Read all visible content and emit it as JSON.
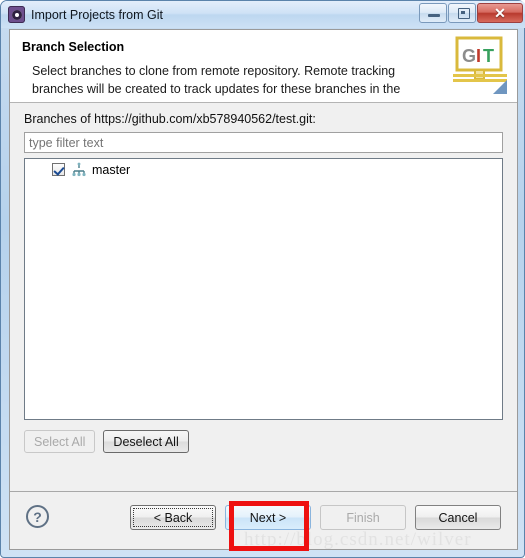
{
  "window": {
    "title": "Import Projects from Git",
    "icon": "eclipse-wizard-icon",
    "controls": {
      "minimize": "minimize-button",
      "restore": "restore-button",
      "close": "✕"
    }
  },
  "header": {
    "title": "Branch Selection",
    "description": "Select branches to clone from remote repository. Remote tracking\nbranches will be created to track updates for these branches in the",
    "logo": {
      "name": "git-logo",
      "letters": [
        "G",
        "I",
        "T"
      ],
      "colors": {
        "g": "#808080",
        "i": "#c0392b",
        "t": "#27ae60",
        "frame": "#d9b93c"
      }
    }
  },
  "content": {
    "branches_label": "Branches of https://github.com/xb578940562/test.git:",
    "filter": {
      "placeholder": "type filter text",
      "value": ""
    },
    "branches": [
      {
        "label": "master",
        "checked": true,
        "icon": "branch-icon"
      }
    ],
    "list_buttons": [
      {
        "label": "Select All",
        "enabled": false
      },
      {
        "label": "Deselect All",
        "enabled": true
      }
    ]
  },
  "footer": {
    "help": "?",
    "buttons": [
      {
        "label": "< Back",
        "state": "focused"
      },
      {
        "label": "Next >",
        "state": "primary"
      },
      {
        "label": "Finish",
        "state": "disabled"
      },
      {
        "label": "Cancel",
        "state": "normal"
      }
    ]
  },
  "annotation": {
    "highlight_target": "Next >",
    "color": "#ee1111"
  },
  "watermark": "http://blog.csdn.net/wilver"
}
